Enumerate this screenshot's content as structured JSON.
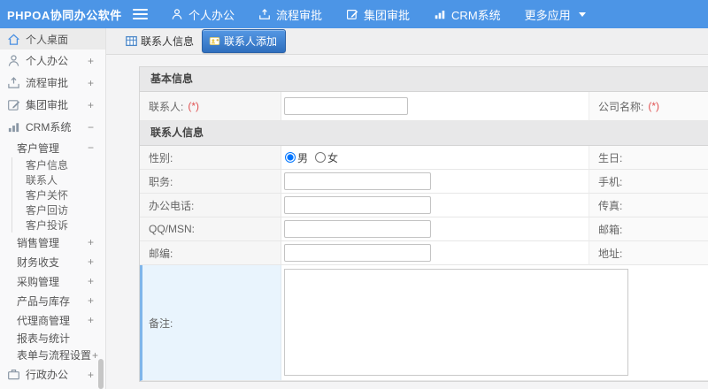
{
  "colors": {
    "topbar": "#4c95e6",
    "active_tab": "#2f6fbe",
    "required": "#e05252",
    "remark_highlight": "#e9f4fd"
  },
  "topbar": {
    "logo": "PHPOA协同办公软件",
    "menu": [
      {
        "label": "个人办公",
        "icon": "user-icon"
      },
      {
        "label": "流程审批",
        "icon": "approval-upload-icon"
      },
      {
        "label": "集团审批",
        "icon": "edit-icon"
      },
      {
        "label": "CRM系统",
        "icon": "bar-chart-icon"
      },
      {
        "label": "更多应用",
        "icon": "caret-down-icon"
      }
    ]
  },
  "sidebar": {
    "items": [
      {
        "label": "个人桌面",
        "icon": "home-icon",
        "toggle": ""
      },
      {
        "label": "个人办公",
        "icon": "user-icon",
        "toggle": "+"
      },
      {
        "label": "流程审批",
        "icon": "approval-upload-icon",
        "toggle": "+"
      },
      {
        "label": "集团审批",
        "icon": "edit-icon",
        "toggle": "+"
      },
      {
        "label": "CRM系统",
        "icon": "bar-chart-icon",
        "toggle": "−"
      },
      {
        "label": "客户管理",
        "toggle": "−"
      },
      {
        "label": "客户信息",
        "toggle": ""
      },
      {
        "label": "联系人",
        "toggle": ""
      },
      {
        "label": "客户关怀",
        "toggle": ""
      },
      {
        "label": "客户回访",
        "toggle": ""
      },
      {
        "label": "客户投诉",
        "toggle": ""
      },
      {
        "label": "销售管理",
        "toggle": "+"
      },
      {
        "label": "财务收支",
        "toggle": "+"
      },
      {
        "label": "采购管理",
        "toggle": "+"
      },
      {
        "label": "产品与库存",
        "toggle": "+"
      },
      {
        "label": "代理商管理",
        "toggle": "+"
      },
      {
        "label": "报表与统计",
        "toggle": ""
      },
      {
        "label": "表单与流程设置",
        "toggle": "+"
      },
      {
        "label": "行政办公",
        "icon": "briefcase-icon",
        "toggle": "+"
      }
    ]
  },
  "tabs": [
    {
      "label": "联系人信息",
      "icon": "table-icon",
      "active": false
    },
    {
      "label": "联系人添加",
      "icon": "add-contact-icon",
      "active": true
    }
  ],
  "form": {
    "section_basic": "基本信息",
    "section_contact": "联系人信息",
    "required": "(*)",
    "row_name": {
      "left": "联系人:",
      "left_value": "",
      "right": "公司名称:"
    },
    "row_gender": {
      "left": "性别:",
      "male": "男",
      "female": "女",
      "selected": "男",
      "right": "生日:"
    },
    "rows": [
      {
        "left": "职务:",
        "left_value": "",
        "right": "手机:"
      },
      {
        "left": "办公电话:",
        "left_value": "",
        "right": "传真:"
      },
      {
        "left": "QQ/MSN:",
        "left_value": "",
        "right": "邮箱:"
      },
      {
        "left": "邮编:",
        "left_value": "",
        "right": "地址:"
      }
    ],
    "row_remark": {
      "left": "备注:",
      "value": ""
    }
  }
}
